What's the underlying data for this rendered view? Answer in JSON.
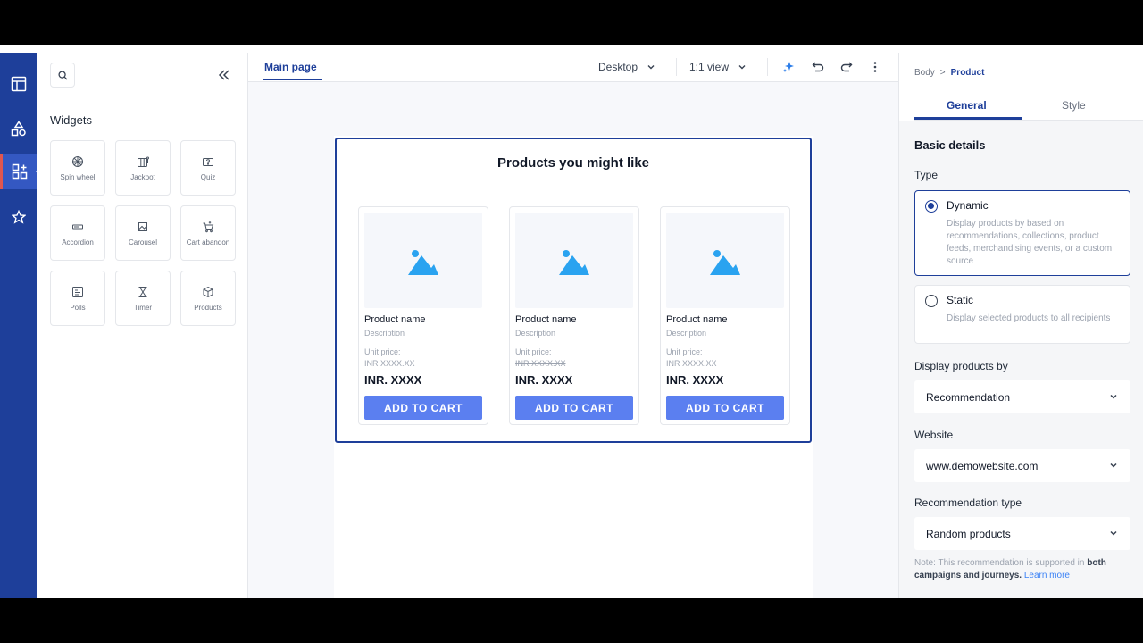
{
  "rail": {
    "items": [
      {
        "icon": "layout-icon"
      },
      {
        "icon": "shapes-icon"
      },
      {
        "icon": "widgets-icon"
      },
      {
        "icon": "star-icon"
      }
    ]
  },
  "widgets": {
    "title": "Widgets",
    "items": [
      {
        "label": "Spin wheel",
        "icon": "spin-wheel-icon"
      },
      {
        "label": "Jackpot",
        "icon": "jackpot-icon"
      },
      {
        "label": "Quiz",
        "icon": "quiz-icon"
      },
      {
        "label": "Accordion",
        "icon": "accordion-icon"
      },
      {
        "label": "Carousel",
        "icon": "carousel-icon"
      },
      {
        "label": "Cart abandon",
        "icon": "cart-abandon-icon"
      },
      {
        "label": "Polls",
        "icon": "polls-icon"
      },
      {
        "label": "Timer",
        "icon": "timer-icon"
      },
      {
        "label": "Products",
        "icon": "products-icon"
      }
    ]
  },
  "topbar": {
    "tab": "Main page",
    "device": "Desktop",
    "zoom": "1:1 view"
  },
  "block": {
    "title": "Products you might like",
    "products": [
      {
        "name": "Product name",
        "description": "Description",
        "unit_label": "Unit price:",
        "old_price": "INR XXXX.XX",
        "price": "INR. XXXX",
        "button": "ADD TO CART"
      },
      {
        "name": "Product name",
        "description": "Description",
        "unit_label": "Unit price:",
        "old_price": "INR XXXX.XX",
        "price": "INR. XXXX",
        "button": "ADD TO CART"
      },
      {
        "name": "Product name",
        "description": "Description",
        "unit_label": "Unit price:",
        "old_price": "INR XXXX.XX",
        "price": "INR. XXXX",
        "button": "ADD TO CART"
      }
    ]
  },
  "right": {
    "breadcrumb": {
      "root": "Body",
      "separator": ">",
      "current": "Product"
    },
    "tabs": {
      "general": "General",
      "style": "Style"
    },
    "section_title": "Basic details",
    "type_label": "Type",
    "options": [
      {
        "title": "Dynamic",
        "desc": "Display products by based on recommendations, collections, product feeds, merchandising events, or a custom source",
        "selected": true
      },
      {
        "title": "Static",
        "desc": "Display selected products to all recipients",
        "selected": false
      }
    ],
    "display_by": {
      "label": "Display products by",
      "value": "Recommendation"
    },
    "website": {
      "label": "Website",
      "value": "www.demowebsite.com"
    },
    "rec_type": {
      "label": "Recommendation type",
      "value": "Random products"
    },
    "note": {
      "prefix": "Note: This recommendation is supported in",
      "bold": "both campaigns and journeys.",
      "link": "Learn more"
    }
  },
  "colors": {
    "brand": "#1e3f9a",
    "button": "#5b7ff0",
    "image": "#2aa3f0"
  }
}
